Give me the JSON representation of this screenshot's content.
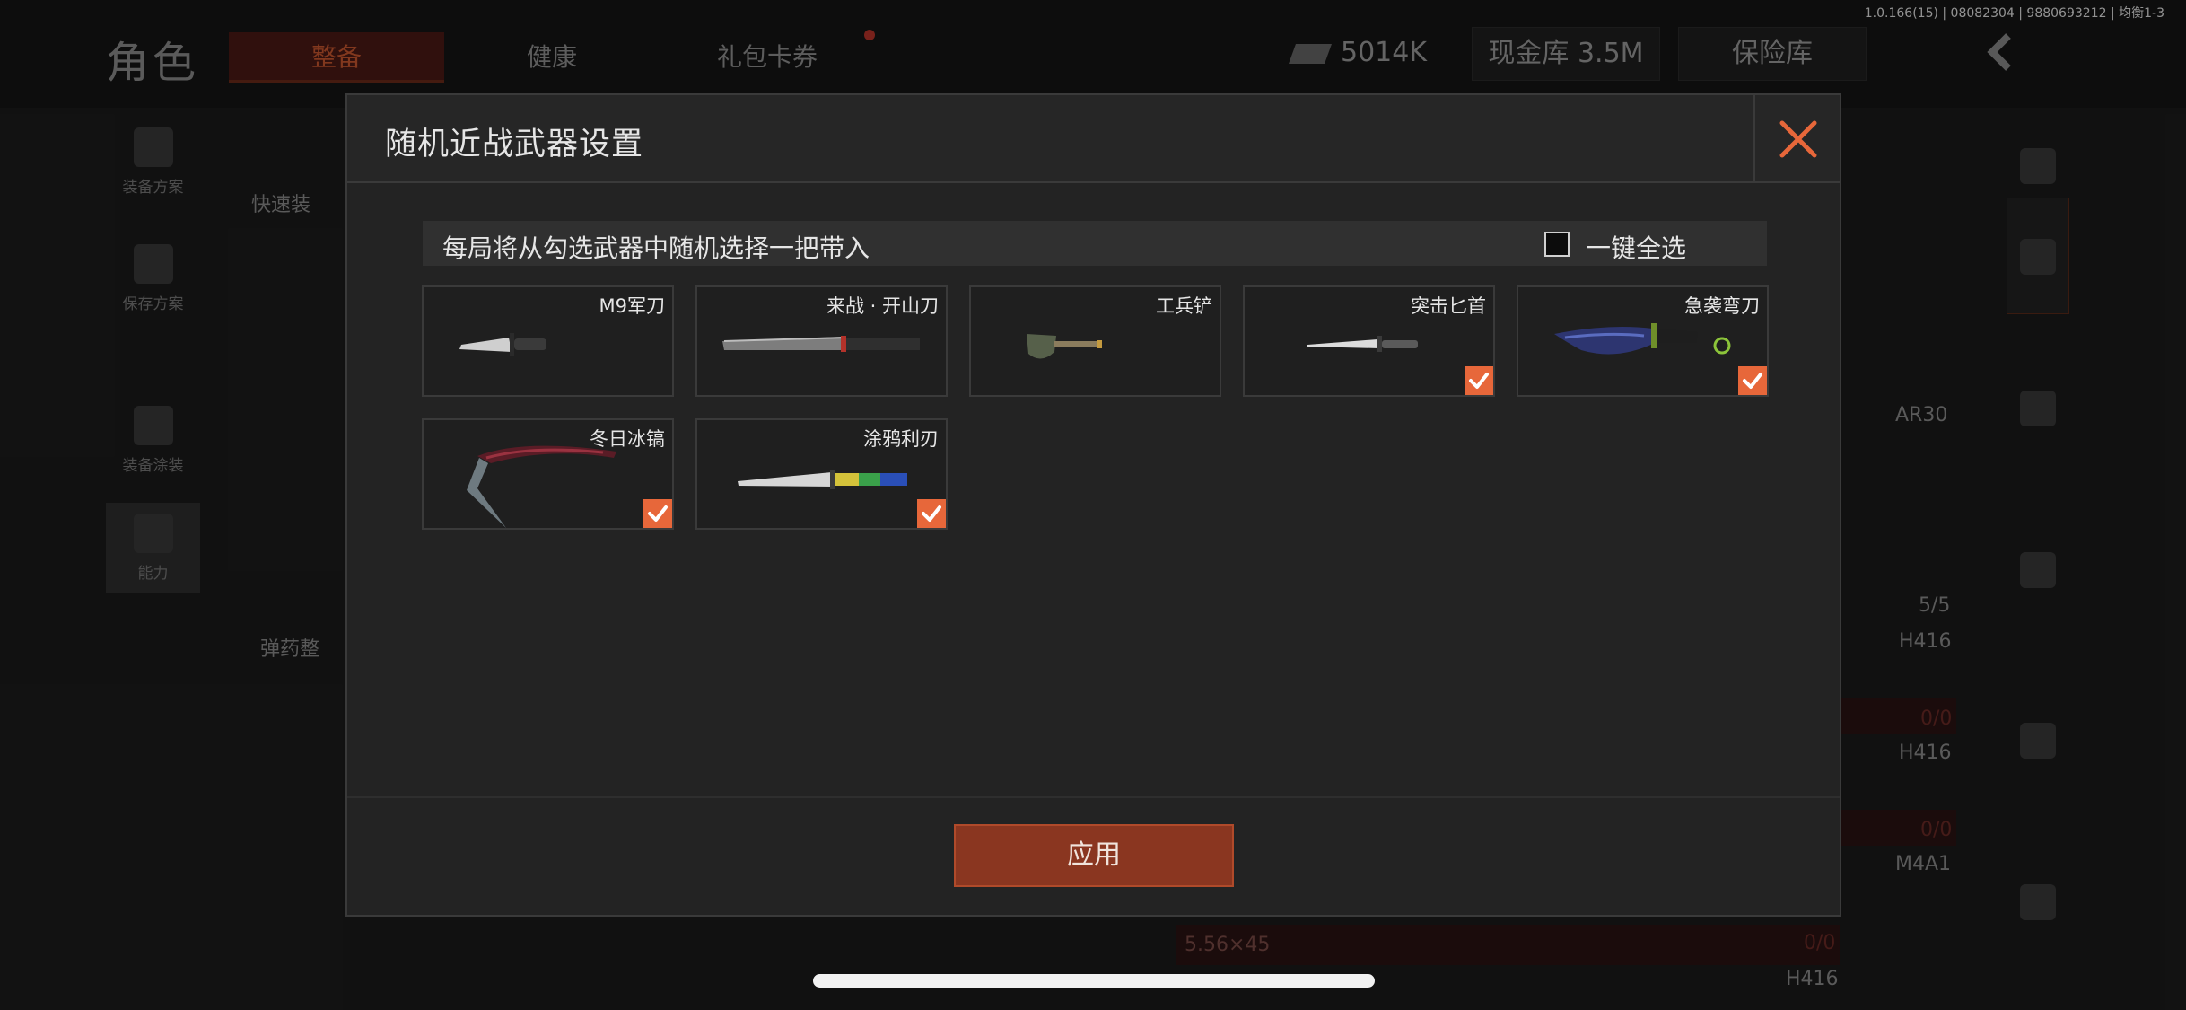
{
  "background": {
    "title": "角色",
    "tabs": [
      {
        "label": "整备",
        "active": true
      },
      {
        "label": "健康",
        "active": false
      },
      {
        "label": "礼包卡券",
        "active": false
      }
    ],
    "currency_value": "5014K",
    "cash_vault": "现金库 3.5M",
    "safe_box": "保险库",
    "version": "1.0.166(15) | 08082304 | 9880693212 | 均衡1-3",
    "left_nav": [
      "装备方案",
      "保存方案",
      "装备涂装",
      "能力"
    ],
    "labels": {
      "quick_equip": "快速装",
      "ammo": "弹药整",
      "ammo_caliber": "5.56×45",
      "ammo_count_1": "0/0",
      "ammo_count_2": "0/0",
      "ammo_count_3": "0/0",
      "mag_count": "5/5",
      "gun_1": "AR30",
      "gun_2": "H416",
      "gun_3": "H416",
      "gun_4": "M4A1",
      "gun_5": "H416"
    }
  },
  "modal": {
    "title": "随机近战武器设置",
    "hint": "每局将从勾选武器中随机选择一把带入",
    "select_all_label": "一键全选",
    "select_all_checked": false,
    "apply_label": "应用",
    "accent_color": "#e7673a",
    "weapons": [
      {
        "name": "M9军刀",
        "checked": false
      },
      {
        "name": "来战 · 开山刀",
        "checked": false
      },
      {
        "name": "工兵铲",
        "checked": false
      },
      {
        "name": "突击匕首",
        "checked": true
      },
      {
        "name": "急袭弯刀",
        "checked": true
      },
      {
        "name": "冬日冰镐",
        "checked": true
      },
      {
        "name": "涂鸦利刃",
        "checked": true
      }
    ]
  }
}
